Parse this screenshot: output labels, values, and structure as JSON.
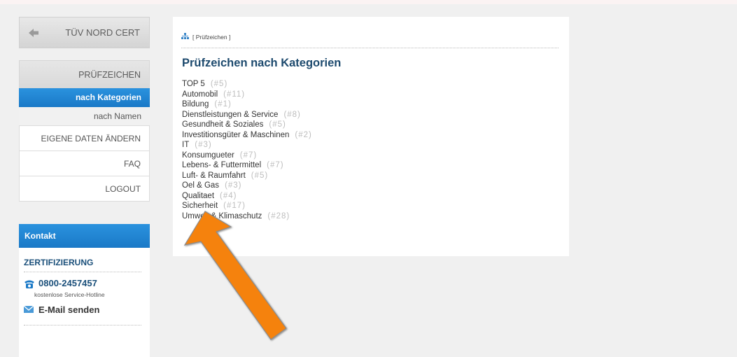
{
  "back": {
    "label": "TÜV NORD CERT"
  },
  "nav": {
    "header": "PRÜFZEICHEN",
    "sub_items": [
      {
        "label": "nach Kategorien",
        "selected": true
      },
      {
        "label": "nach Namen",
        "selected": false
      }
    ],
    "main_items": [
      {
        "label": "EIGENE DATEN ÄNDERN"
      },
      {
        "label": "FAQ"
      },
      {
        "label": "LOGOUT"
      }
    ]
  },
  "contact": {
    "header": "Kontakt",
    "section_title": "ZERTIFIZIERUNG",
    "phone": "0800-2457457",
    "hotline_label": "kostenlose Service-Hotline",
    "email_link": "E-Mail senden"
  },
  "main": {
    "breadcrumb": "[ Prüfzeichen ]",
    "title": "Prüfzeichen nach Kategorien",
    "categories": [
      {
        "name": "TOP 5",
        "count": "(#5)"
      },
      {
        "name": "Automobil",
        "count": "(#11)"
      },
      {
        "name": "Bildung",
        "count": "(#1)"
      },
      {
        "name": "Dienstleistungen & Service",
        "count": "(#8)"
      },
      {
        "name": "Gesundheit & Soziales",
        "count": "(#5)"
      },
      {
        "name": "Investitionsgüter & Maschinen",
        "count": "(#2)"
      },
      {
        "name": "IT",
        "count": "(#3)"
      },
      {
        "name": "Konsumgueter",
        "count": "(#7)"
      },
      {
        "name": "Lebens- & Futtermittel",
        "count": "(#7)"
      },
      {
        "name": "Luft- & Raumfahrt",
        "count": "(#5)"
      },
      {
        "name": "Oel & Gas",
        "count": "(#3)"
      },
      {
        "name": "Qualitaet",
        "count": "(#4)"
      },
      {
        "name": "Sicherheit",
        "count": "(#17)"
      },
      {
        "name": "Umwelt & Klimaschutz",
        "count": "(#28)"
      }
    ]
  },
  "colors": {
    "accent_blue": "#1a79c7",
    "title_blue": "#1d4a6e",
    "arrow_orange": "#f5820f"
  },
  "icons": {
    "back": "arrow-left-icon",
    "phone": "phone-icon",
    "mail": "mail-icon",
    "breadcrumb": "sitemap-icon"
  }
}
